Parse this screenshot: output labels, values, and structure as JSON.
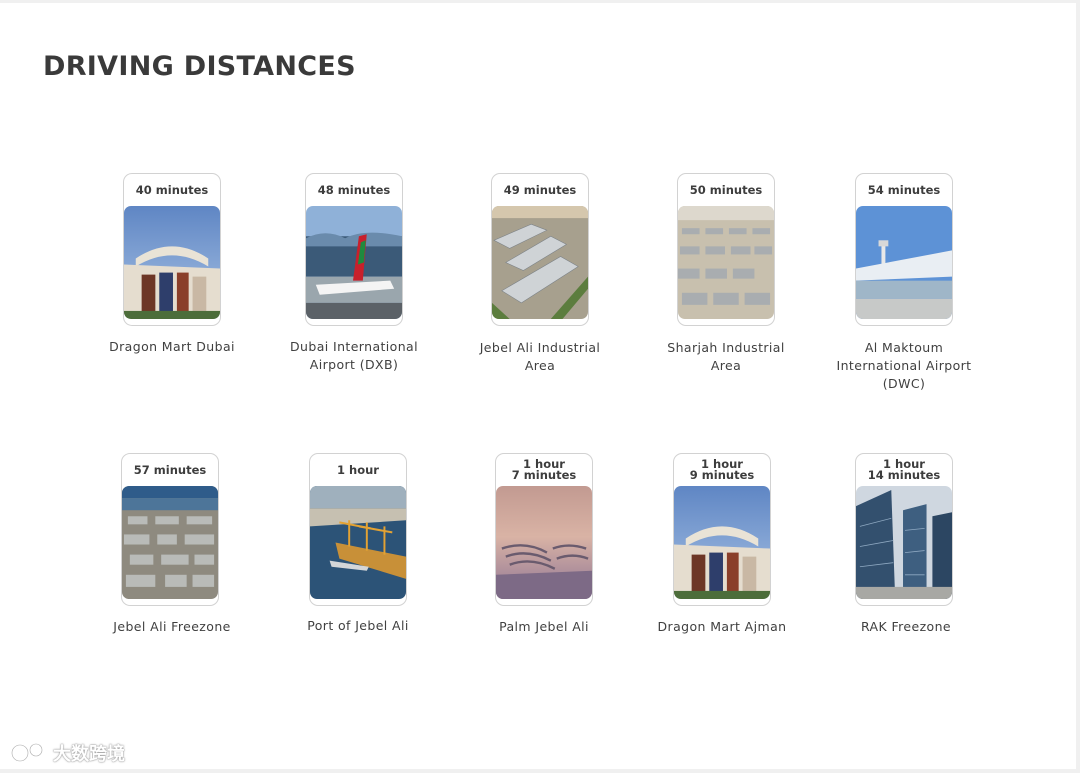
{
  "page": {
    "title": "DRIVING DISTANCES"
  },
  "destinations": [
    {
      "time": "40 minutes",
      "label": "Dragon Mart Dubai",
      "photo": "dragon-mart-building"
    },
    {
      "time": "48 minutes",
      "label": "Dubai International Airport (DXB)",
      "photo": "airport-plane"
    },
    {
      "time": "49 minutes",
      "label": "Jebel Ali Industrial Area",
      "photo": "warehouses-aerial"
    },
    {
      "time": "50 minutes",
      "label": "Sharjah Industrial Area",
      "photo": "industrial-aerial"
    },
    {
      "time": "54 minutes",
      "label": "Al Maktoum International Airport (DWC)",
      "photo": "terminal-building"
    },
    {
      "time": "57 minutes",
      "label": "Jebel Ali Freezone",
      "photo": "freezone-aerial"
    },
    {
      "time": "1 hour",
      "label": "Port of Jebel Ali",
      "photo": "port-cranes"
    },
    {
      "time": "1 hour\n7 minutes",
      "label": "Palm Jebel Ali",
      "photo": "palm-island-sunset"
    },
    {
      "time": "1 hour\n9 minutes",
      "label": "Dragon Mart Ajman",
      "photo": "dragon-mart-building"
    },
    {
      "time": "1 hour\n14 minutes",
      "label": "RAK Freezone",
      "photo": "office-towers"
    }
  ],
  "watermark": {
    "text": "大数跨境",
    "icon": "brand-logo-icon"
  }
}
